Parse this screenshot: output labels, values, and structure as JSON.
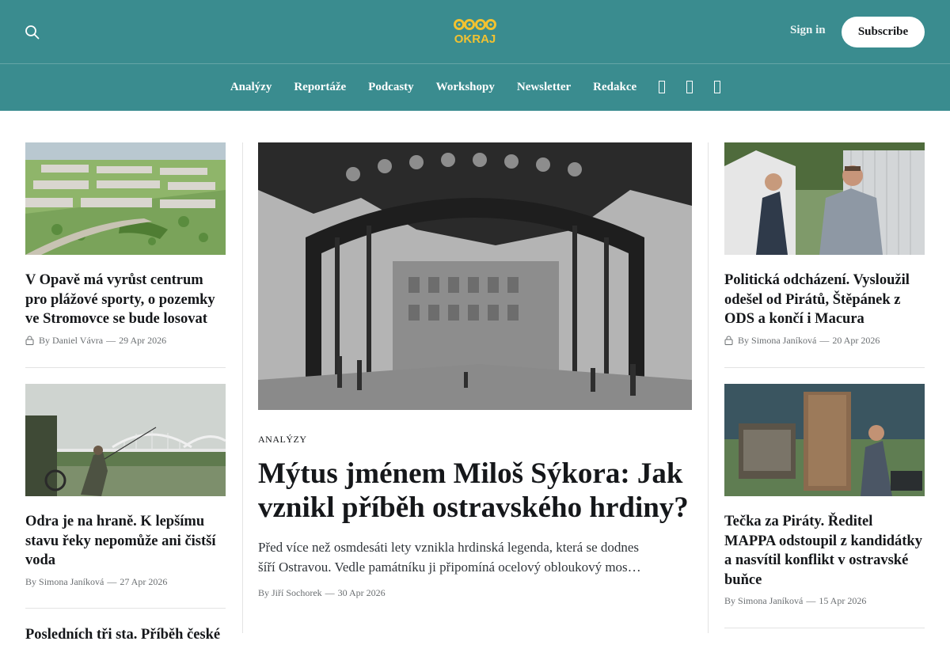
{
  "header": {
    "logo_text": "OKRAJ",
    "sign_in": "Sign in",
    "subscribe": "Subscribe",
    "icons": {
      "search": "search-icon",
      "social": [
        "facebook-icon",
        "instagram-icon",
        "x-icon"
      ]
    }
  },
  "nav": {
    "items": [
      "Analýzy",
      "Reportáže",
      "Podcasty",
      "Workshopy",
      "Newsletter",
      "Redakce"
    ]
  },
  "colors": {
    "header_bg": "#3a8c8f",
    "logo": "#f2c230",
    "text": "#15171a",
    "meta": "#6b6f72"
  },
  "left_column": [
    {
      "title": "V Opavě má vyrůst centrum pro plážové sporty, o pozemky ve Stromovce se bude losovat",
      "by": "By",
      "author": "Daniel Vávra",
      "sep": "—",
      "date": "29 Apr 2026",
      "locked": true
    },
    {
      "title": "Odra je na hraně. K lepšímu stavu řeky nepomůže ani čistší voda",
      "by": "By",
      "author": "Simona Janíková",
      "sep": "—",
      "date": "27 Apr 2026",
      "locked": false
    },
    {
      "title": "Posledních tři sta. Příběh české"
    }
  ],
  "feature": {
    "tag": "ANALÝZY",
    "title": "Mýtus jménem Miloš Sýkora: Jak vznikl příběh ostravského hrdiny?",
    "excerpt": "Před více než osmdesáti lety vznikla hrdinská legenda, která se dodnes šíří Ostravou. Vedle památníku ji připomíná ocelový obloukový mos…",
    "by": "By",
    "author": "Jiří Sochorek",
    "sep": "—",
    "date": "30 Apr 2026"
  },
  "right_column": [
    {
      "title": "Politická odcházení. Vysloužil odešel od Pirátů, Štěpánek z ODS a končí i Macura",
      "by": "By",
      "author": "Simona Janíková",
      "sep": "—",
      "date": "20 Apr 2026",
      "locked": true
    },
    {
      "title": "Tečka za Piráty. Ředitel MAPPA odstoupil z kandidátky a nasvítil konflikt v ostravské buňce",
      "by": "By",
      "author": "Simona Janíková",
      "sep": "—",
      "date": "15 Apr 2026",
      "locked": false
    }
  ]
}
